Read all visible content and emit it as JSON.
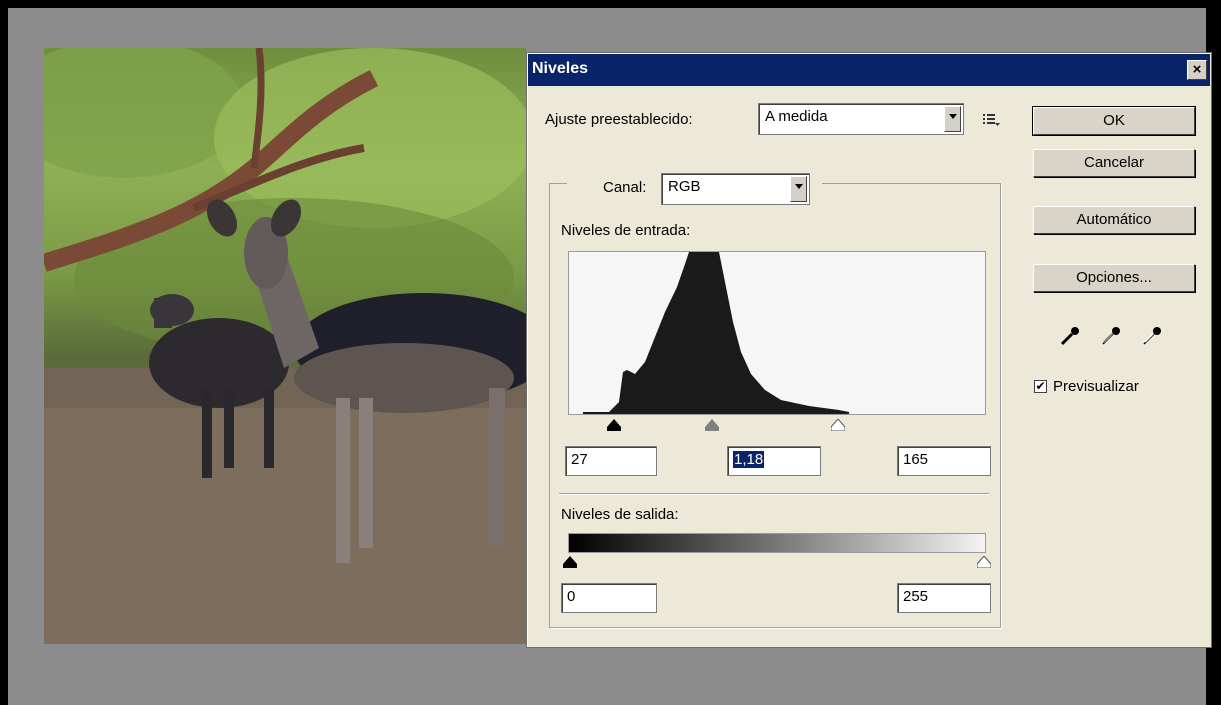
{
  "dialog": {
    "title": "Niveles",
    "close_glyph": "×",
    "preset_label": "Ajuste preestablecido:",
    "preset_value": "A medida",
    "channel_label": "Canal:",
    "channel_value": "RGB",
    "input_levels_label": "Niveles de entrada:",
    "input_black": "27",
    "input_gamma": "1,18",
    "input_white": "165",
    "output_levels_label": "Niveles de salida:",
    "output_black": "0",
    "output_white": "255",
    "preview_label": "Previsualizar",
    "preview_checked": true
  },
  "buttons": {
    "ok": "OK",
    "cancel": "Cancelar",
    "auto": "Automático",
    "options": "Opciones..."
  },
  "icons": {
    "preset_menu": "preset-menu-icon",
    "eyedroppers": [
      "black-eyedropper-icon",
      "gray-eyedropper-icon",
      "white-eyedropper-icon"
    ]
  },
  "colors": {
    "titlebar": "#0a246a",
    "dialog_bg": "#ece9d8",
    "workspace": "#8c8c8c"
  }
}
